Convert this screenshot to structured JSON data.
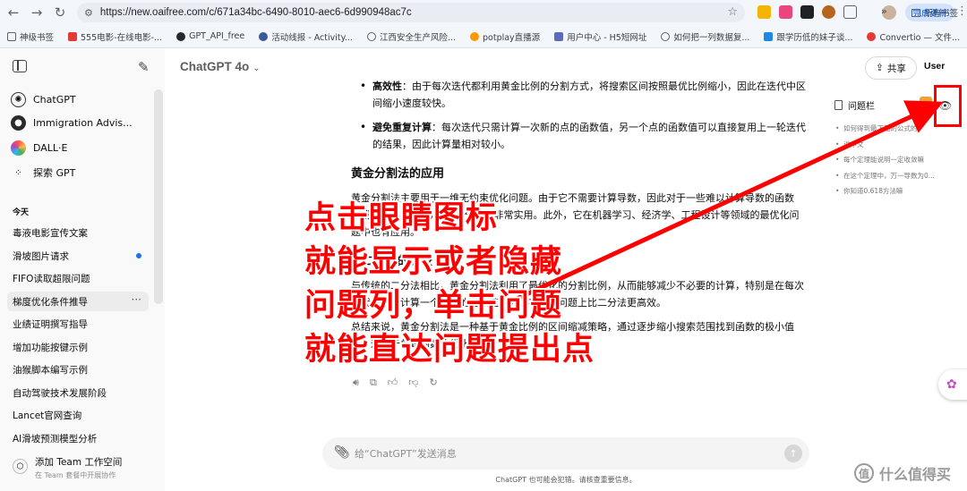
{
  "browser": {
    "url": "https://new.oaifree.com/c/671a34bc-6490-8010-aec6-6d990948ac7c",
    "update_label": "完成更新",
    "bookmarks": [
      "神级书签",
      "555电影-在线电影-...",
      "GPT_API_free",
      "活动线报 - Activity...",
      "江西安全生产风险...",
      "potplay直播源",
      "用户中心 - H5短网址",
      "如何把一列数据复...",
      "跟学历低的妹子谈...",
      "Convertio — 文件..."
    ],
    "all_bookmarks_label": "所有书签"
  },
  "sidebar": {
    "gpts": [
      {
        "label": "ChatGPT",
        "icon": "openai-icon"
      },
      {
        "label": "Immigration Advis...",
        "icon": "immigration-avatar-icon"
      },
      {
        "label": "DALL·E",
        "icon": "dalle-icon"
      },
      {
        "label": "探索 GPT",
        "icon": "grid-icon"
      }
    ],
    "section_today": "今天",
    "chats": [
      "毒液电影宣传文案",
      "滑坡图片请求",
      "FIFO读取超限问题",
      "梯度优化条件推导",
      "业绩证明撰写指导",
      "增加功能按键示例",
      "油猴脚本编写示例",
      "自动驾驶技术发展阶段",
      "Lancet官网查询",
      "AI滑坡预测模型分析"
    ],
    "team_title": "添加 Team 工作空间",
    "team_sub": "在 Team 套餐中开展协作"
  },
  "header": {
    "model": "ChatGPT 4o",
    "share_label": "共享",
    "user_label": "User"
  },
  "content": {
    "bullet1_title": "高效性",
    "bullet1_text": "：由于每次迭代都利用黄金比例的分割方式，将搜索区间按照最优比例缩小，因此在迭代中区间缩小速度较快。",
    "bullet2_title": "避免重复计算",
    "bullet2_text": "：每次迭代只需计算一次新的点的函数值，另一个点的函数值可以直接复用上一轮迭代的结果，因此计算量相对较小。",
    "heading_app": "黄金分割法的应用",
    "para_app": "黄金分割法主要用于一维无约束优化问题。由于它不需要计算导数，因此对于一些难以计算导数的函数（或不可导的函数），黄金分割法非常实用。此外，它在机器学习、经济学、工程设计等领域的最优化问题中也有应用。",
    "heading_cmp": "与二分法的比较",
    "para_cmp": "与传统的二分法相比，黄金分割法利用了最优化的分割比例，从而能够减少不必要的计算，特别是在每次迭代时只需计算一个新点的函数值，因此在某些问题上比二分法更高效。",
    "para_sum": "总结来说，黄金分割法是一种基于黄金比例的区间缩减策略，通过逐步缩小搜索范围找到函数的极小值点，适用于单峰函数的优化问题。"
  },
  "question_panel": {
    "title": "问题栏",
    "items": [
      "如何得到最下面的公式的",
      "说中文",
      "每个定理能说明一定收敛嘛",
      "在这个定理中，万一导数为0...",
      "你知道0.618方法嘛"
    ]
  },
  "composer": {
    "placeholder": "给“ChatGPT”发送消息",
    "disclaimer": "ChatGPT 也可能会犯错。请核查重要信息。"
  },
  "watermark": "什么值得买",
  "annotation": {
    "lines": [
      "点击眼睛图标",
      "就能显示或者隐藏",
      "问题列，单击问题",
      "就能直达问题提出点"
    ],
    "color": "#ff0000"
  }
}
